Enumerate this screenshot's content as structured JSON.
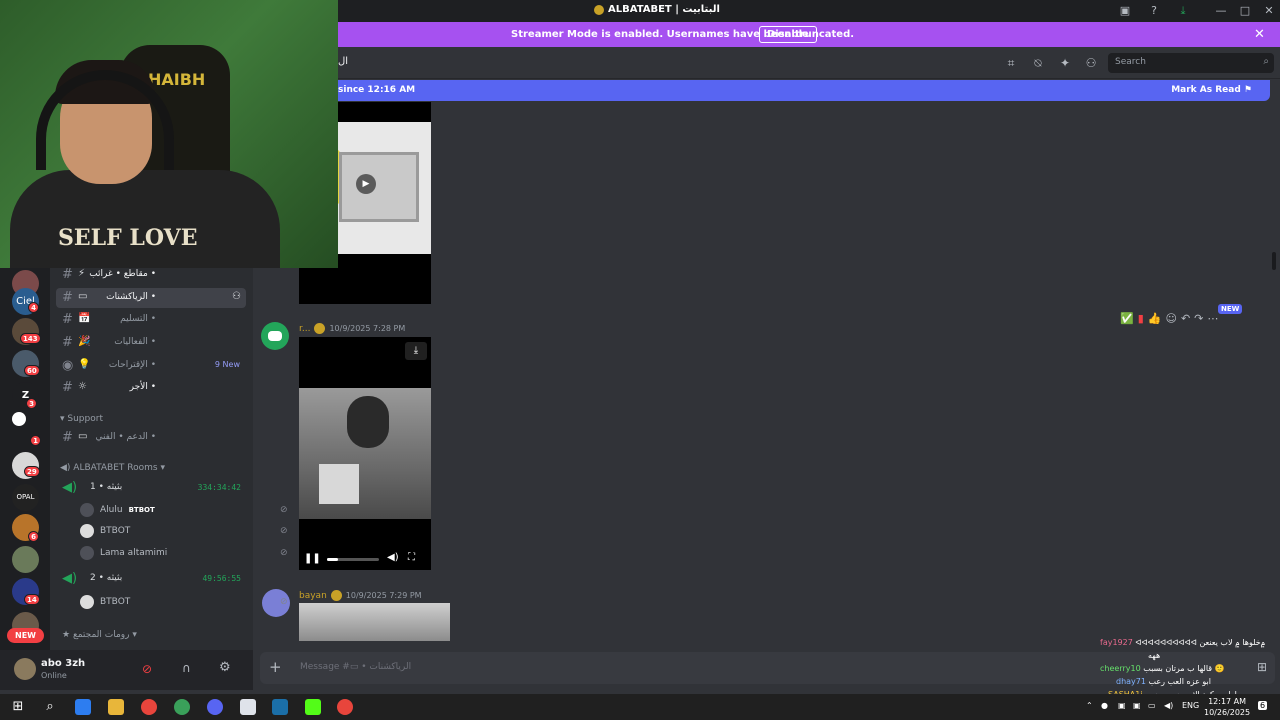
{
  "window": {
    "title": "ALBATABET | البتابيت"
  },
  "banner": {
    "message": "Streamer Mode is enabled. Usernames have been truncated.",
    "disable_label": "Disable"
  },
  "header": {
    "channel_fragment": "ال",
    "search_placeholder": "Search"
  },
  "new_messages": {
    "since": "since 12:16 AM",
    "mark_read": "Mark As Read"
  },
  "servers": {
    "badges": [
      "4",
      "143",
      "60",
      "3",
      "1",
      "29",
      "6",
      "14"
    ],
    "new_label": "NEW"
  },
  "channels": [
    {
      "emoji": "⚡",
      "name": "مقاطع • غرائب •"
    },
    {
      "emoji": "▭",
      "name": "الرياكشنات •"
    },
    {
      "emoji": "📅",
      "name": "التسليم •"
    },
    {
      "emoji": "🎉",
      "name": "الفعاليات •"
    },
    {
      "emoji": "💡",
      "name": "الإقتراحات •",
      "badge": "9 New"
    },
    {
      "emoji": "☼",
      "name": "الأجر •"
    }
  ],
  "support": {
    "category": "Support",
    "channel_name": "الدعم • الفني •"
  },
  "rooms": {
    "category": "ALBATABET Rooms",
    "room1": {
      "name": "1 • بثيثه",
      "timer": "334:34:42"
    },
    "room1_users": [
      "Alulu",
      "BTBOT",
      "Lama altamimi"
    ],
    "room1_tag": "BTBOT",
    "room2": {
      "name": "2 • بثيثه",
      "timer": "49:56:55"
    },
    "room2_users": [
      "BTBOT"
    ],
    "community": "رومات المجتمع"
  },
  "user": {
    "name": "abo 3zh",
    "status": "Online"
  },
  "messages": {
    "msg1": {
      "author": "r...",
      "timestamp": "10/9/2025 7:28 PM"
    },
    "msg2": {
      "author": "bayan",
      "timestamp": "10/9/2025 7:29 PM"
    },
    "new_tag": "NEW"
  },
  "composer": {
    "placeholder": "Message #▭ • الرياكشنات"
  },
  "webcam": {
    "chair_text": "HAIBH",
    "shirt_text": "SELF LOVE"
  },
  "chat_overlay": [
    {
      "user": "fay1927",
      "text": "ᐊᐊᐊᐊᐊᐊᐊᐊᐊᐊ ۾خلوها ۾ لاب يعنعن"
    },
    {
      "user": "",
      "text": "ههه"
    },
    {
      "user": "cheerry10",
      "text": "قالها ب مرتان بسبب 🙂"
    },
    {
      "user": "dhay71",
      "text": "ابو عزه العب رعب"
    },
    {
      "user": "SASHA1i",
      "text": "اوام سكود الثو رحت و جيت"
    }
  ],
  "taskbar": {
    "lang": "ENG",
    "time": "12:17 AM",
    "date": "10/26/2025",
    "notif": "6"
  }
}
